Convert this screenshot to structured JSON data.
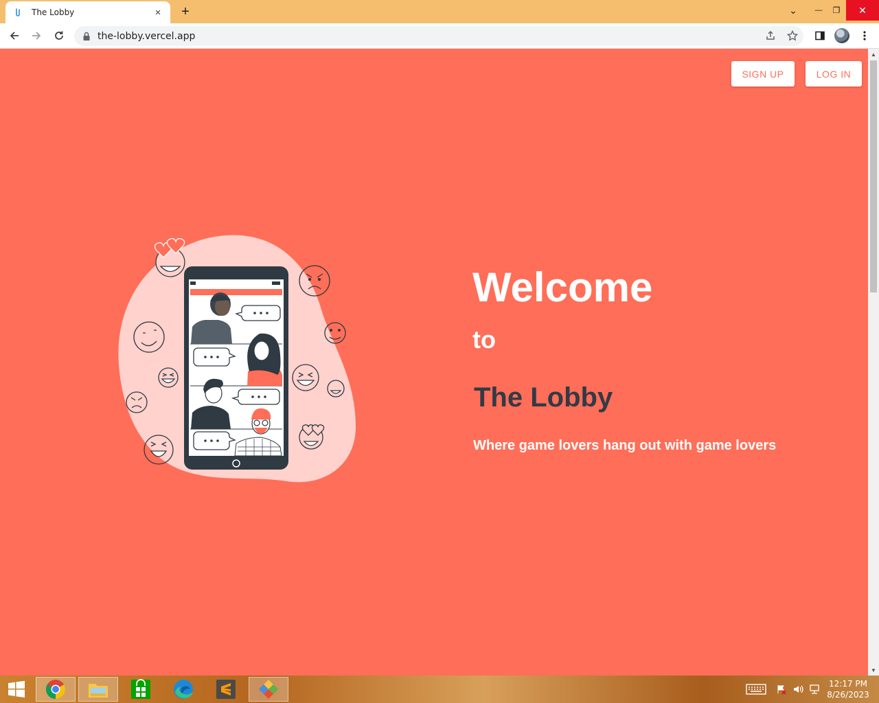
{
  "browser": {
    "tab_title": "The Lobby",
    "tab_close": "×",
    "new_tab": "+",
    "url": "the-lobby.vercel.app",
    "icons": [
      "back-icon",
      "forward-icon",
      "reload-icon",
      "lock-icon",
      "share-icon",
      "star-icon",
      "side-panel-icon",
      "profile-avatar",
      "menu-icon"
    ]
  },
  "window_controls": {
    "chevron": "⌄",
    "minimize": "—",
    "restore": "❐",
    "close": "✕"
  },
  "page": {
    "signup_label": "SIGN UP",
    "login_label": "LOG IN",
    "welcome": "Welcome",
    "to": "to",
    "brand": "The Lobby",
    "tagline": "Where game lovers hang out with game lovers",
    "colors": {
      "background": "#ff6e58",
      "brand_text": "#323a45",
      "button_bg": "#ffffff",
      "button_text": "#ff6e58"
    }
  },
  "taskbar": {
    "apps": [
      "windows-start-icon",
      "chrome-icon",
      "file-explorer-icon",
      "store-icon",
      "edge-icon",
      "sublime-text-icon",
      "git-icon"
    ],
    "time": "12:17 PM",
    "date": "8/26/2023"
  }
}
